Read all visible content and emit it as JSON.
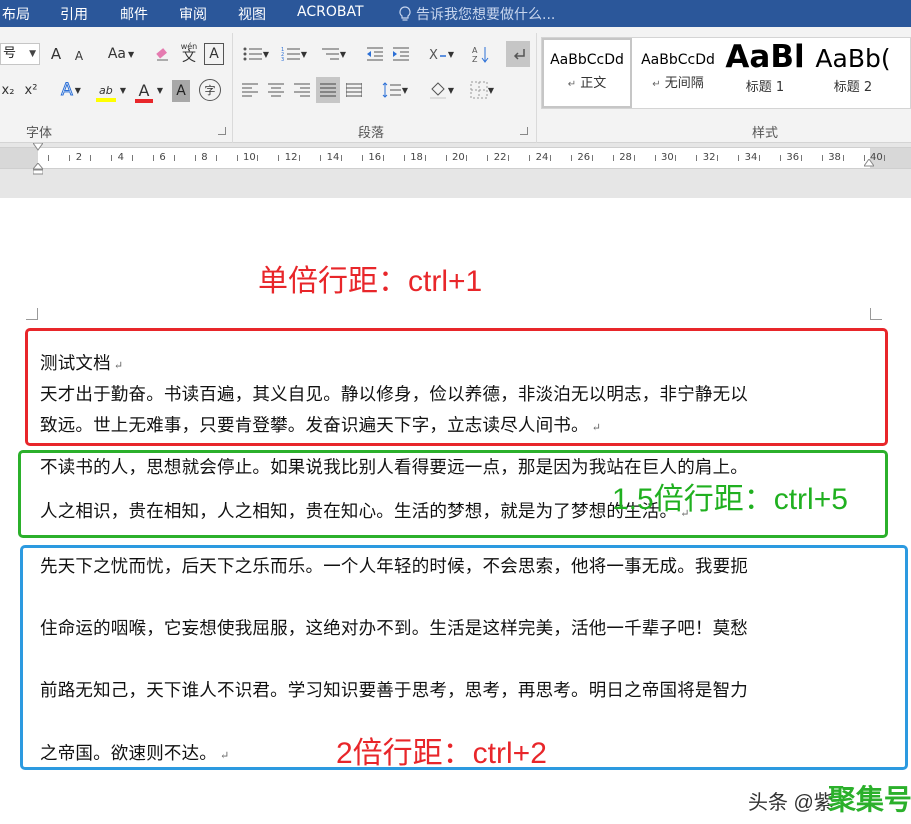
{
  "menubar": {
    "tabs": [
      "布局",
      "引用",
      "邮件",
      "审阅",
      "视图",
      "ACROBAT"
    ],
    "tell_me": "告诉我您想要做什么..."
  },
  "ribbon": {
    "font_size_value": "号",
    "groups": {
      "font": "字体",
      "paragraph": "段落",
      "styles": "样式"
    },
    "font_buttons": {
      "grow": "A",
      "shrink": "A",
      "change_case": "Aa",
      "phonetic_top": "wén",
      "phonetic_bottom": "文",
      "border_char": "A",
      "subscript": "x₂",
      "superscript": "x²",
      "text_effects": "A",
      "highlight": "ab",
      "font_color": "A",
      "char_shading": "A",
      "enclose_char": "字"
    },
    "styles": [
      {
        "sample": "AaBbCcDd",
        "name": "正文",
        "selected": true
      },
      {
        "sample": "AaBbCcDd",
        "name": "无间隔",
        "selected": false
      },
      {
        "sample": "AaBl",
        "name": "标题 1",
        "selected": false
      },
      {
        "sample": "AaBb(",
        "name": "标题 2",
        "selected": false
      }
    ],
    "colors": {
      "highlight": "#ffff00",
      "font_color": "#e8262a"
    }
  },
  "ruler": {
    "numbers": [
      "2",
      "4",
      "6",
      "8",
      "10",
      "12",
      "14",
      "16",
      "18",
      "20",
      "22",
      "24",
      "26",
      "28",
      "30",
      "32",
      "34",
      "36",
      "38",
      "40"
    ]
  },
  "document": {
    "annotations": {
      "single": "单倍行距：ctrl+1",
      "one_half": "1.5倍行距：ctrl+5",
      "double": "2倍行距：ctrl+2"
    },
    "single_block": {
      "title": "测试文档",
      "lines": [
        "天才出于勤奋。书读百遍，其义自见。静以修身，俭以养德，非淡泊无以明志，非宁静无以",
        "致远。世上无难事，只要肯登攀。发奋识遍天下字，立志读尽人间书。"
      ]
    },
    "one_half_block": {
      "lines": [
        "不读书的人，思想就会停止。如果说我比别人看得要远一点，那是因为我站在巨人的肩上。",
        "人之相识，贵在相知，人之相知，贵在知心。生活的梦想，就是为了梦想的生活。"
      ]
    },
    "double_block": {
      "lines": [
        "先天下之忧而忧，后天下之乐而乐。一个人年轻的时候，不会思索，他将一事无成。我要扼",
        "住命运的咽喉，它妄想使我屈服，这绝对办不到。生活是这样完美，活他一千辈子吧！莫愁",
        "前路无知己，天下谁人不识君。学习知识要善于思考，思考，再思考。明日之帝国将是智力",
        "之帝国。欲速则不达。"
      ]
    },
    "paragraph_mark": "↵"
  },
  "watermark": {
    "text": "头条 @紫",
    "brand": "聚集号"
  }
}
